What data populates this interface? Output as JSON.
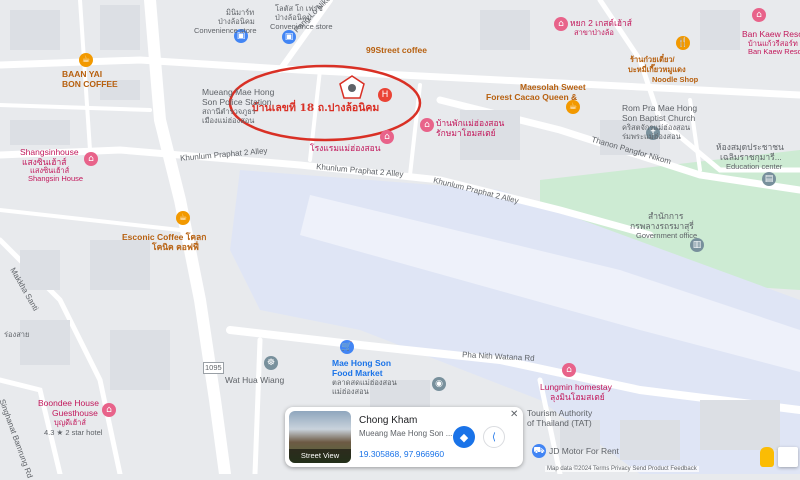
{
  "colors": {
    "road": "#ffffff",
    "block": "#e8eaed",
    "runway": "#dfe5f5",
    "park": "#cdebd3",
    "circle": "#d93025"
  },
  "highlight": {
    "label": "บ้านเลขที่ 18 ถ.ปางล้อนิคม"
  },
  "labels": {
    "minimart": "มินิมาร์ท",
    "bang_lo": "ป่างล้อนิคม",
    "convenience_store": "Convenience store",
    "lotus": "โลตัส โก เฟรช",
    "bang_lo_2": "ป่างล้อนิคม",
    "convenience_store2": "Convenience store",
    "hostel": "หยก 2 เกสต์เฮ้าส์",
    "hostel2": "สาขาป่างล้อ",
    "baan_kaew": "Ban Kaew Reso",
    "baan_kaew2": "บ้านแก้วรีสอร์ท",
    "baan_kaew3": "Ban Kaew Resort",
    "baan_yai": "BAAN YAI",
    "bon_coffee": "BON COFFEE",
    "police": "Mueang Mae Hong",
    "police2": "Son Police Station",
    "police3": "สถานีตำรวจภูธร",
    "police4": "เมืองแม่ฮ่องสอน",
    "coffee99": "99Street coffee",
    "noodle": "ร้านก๋วยเตี๋ยว/",
    "noodle2": "บะหมี่เกี๊ยวหมูแดง",
    "noodle3": "Noodle Shop",
    "maesolah": "Maesolah Sweet",
    "maesolah2": "Forest Cacao Queen &",
    "baptist": "Rom Pra Mae Hong",
    "baptist2": "Son Baptist Church",
    "baptist3": "คริสตจักรแม่ฮ่องสอน",
    "baptist4": "ร่มพระแม่ฮ่องสอน",
    "hospital_th": "โรงแรมแม่ฮ่องสอน",
    "homestay_th": "บ้านพักแม่ฮ่องสอน",
    "homestay_th2": "รักษมาโฮมสเตย์",
    "education": "ห้องสมุดประชาชน",
    "education2": "เฉลิมราชกุมารี...",
    "education3": "Education center",
    "shangsin": "Shangsinhouse",
    "shangsin2": "แสงซินเฮ้าส์",
    "shangsin3": "แสงซินเฮ้าส์",
    "shangsin4": "Shangsin House",
    "govoffice": "สำนักการ",
    "govoffice2": "กรพลางรถรมาสุรี่",
    "govoffice3": "Government office",
    "esconic": "Esconic Coffee โคลก",
    "esconic2": "โคนิค คอฟฟี่",
    "market": "Mae Hong Son",
    "market2": "Food Market",
    "market3": "ตลาดสดแม่ฮ่องสอน",
    "market4": "แม่ฮ่องสอน",
    "wat": "Wat Hua Wiang",
    "lungmin": "Lungmin homestay",
    "lungmin2": "ลุงมินโฮมสเตย์",
    "tat": "Tourism Authority",
    "tat2": "of Thailand (TAT)",
    "jd": "JD Motor For Rent",
    "boondee": "Boondee House",
    "boondee2": "Guesthouse",
    "boondee3": "บุญดีเฮ้าส์",
    "boondee4": "4.3 ★ 2 star hotel",
    "left_th": "ร่องสาย",
    "road_1095": "1095"
  },
  "roads": {
    "pang_lo": "Pang Lo Nikom Rd",
    "khunlum1": "Khunlum Praphat 2 Alley",
    "khunlum2": "Khunlum Praphat 2 Alley",
    "khunlum3": "Khunlum Praphat 2 Alley",
    "thanon": "Thanon Pangfor Nikom",
    "pha_nith": "Pha Nith Watana Rd",
    "makkha": "Makkha Santi",
    "singha": "Singhanat Bamrung Rd"
  },
  "card": {
    "title": "Chong Kham",
    "subtitle": "Mueang Mae Hong Son ...",
    "coords": "19.305868, 97.966960",
    "street_view": "Street View",
    "directions_icon": "directions-icon",
    "share_icon": "share-icon",
    "close_icon": "close-icon"
  },
  "attribution": "Map data ©2024  Terms  Privacy  Send Product Feedback"
}
